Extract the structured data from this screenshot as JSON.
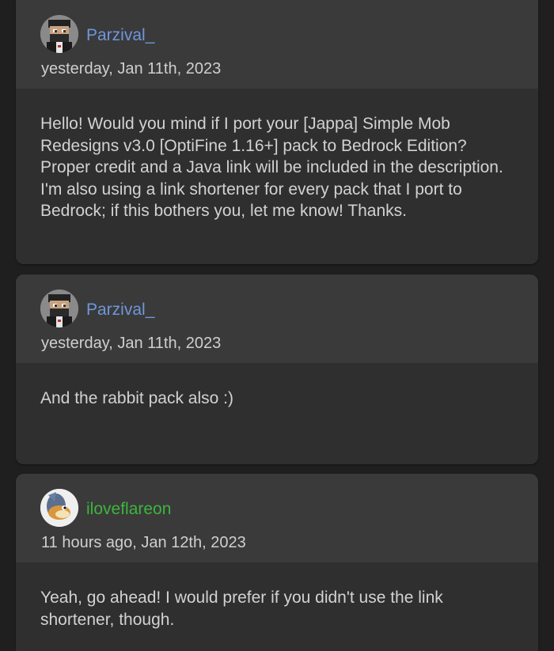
{
  "comments": [
    {
      "username": "Parzival_",
      "username_color": "#6f96dc",
      "avatar_icon": "minecraft-skin-avatar",
      "timestamp": "yesterday, Jan 11th, 2023",
      "body": "Hello! Would you mind if I port your [Jappa] Simple Mob Redesigns v3.0 [OptiFine 1.16+] pack to Bedrock Edition? Proper credit and a Java link will be included in the description. I'm also using a link shortener for every pack that I port to Bedrock; if this bothers you, let me know! Thanks."
    },
    {
      "username": "Parzival_",
      "username_color": "#6f96dc",
      "avatar_icon": "minecraft-skin-avatar",
      "timestamp": "yesterday, Jan 11th, 2023",
      "body": "And the rabbit pack also :)"
    },
    {
      "username": "iloveflareon",
      "username_color": "#3cb53c",
      "avatar_icon": "flareon-avatar",
      "timestamp": "11 hours ago, Jan 12th, 2023",
      "body": "Yeah, go ahead! I would prefer if you didn't use the link shortener, though."
    }
  ]
}
